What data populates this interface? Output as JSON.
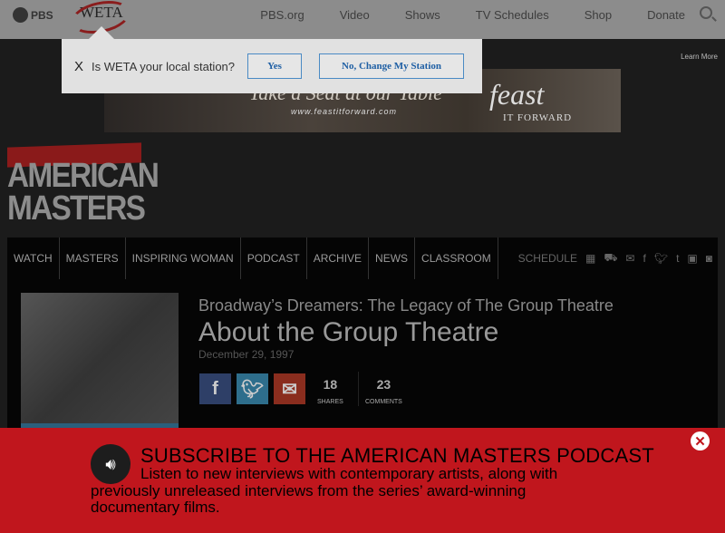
{
  "header": {
    "pbs": "PBS",
    "station": "WETA",
    "nav": [
      "PBS.org",
      "Video",
      "Shows",
      "TV Schedules",
      "Shop",
      "Donate"
    ]
  },
  "popup": {
    "question": "Is WETA your local station?",
    "yes": "Yes",
    "no": "No, Change My Station",
    "close": "X"
  },
  "ad": {
    "learn_more": "Learn More",
    "tagline": "Take a Seat at our Table",
    "url": "www.feastitforward.com",
    "brand": "feast",
    "brand_sub": "IT FORWARD"
  },
  "logo": {
    "line1": "AMERICAN",
    "line2": "MASTERS"
  },
  "menu": {
    "items": [
      "WATCH",
      "MASTERS",
      "INSPIRING WOMAN",
      "PODCAST",
      "ARCHIVE",
      "NEWS",
      "CLASSROOM"
    ],
    "schedule": "SCHEDULE"
  },
  "article": {
    "series": "Broadway’s Dreamers: The Legacy of The Group Theatre",
    "title": "About the Group Theatre",
    "date": "December 29, 1997",
    "shares": "18",
    "shares_label": "SHARES",
    "comments": "23",
    "comments_label": "COMMENTS"
  },
  "banner": {
    "title": "SUBSCRIBE TO THE AMERICAN MASTERS PODCAST",
    "body": "Listen to new interviews with contemporary artists, along with previously unreleased interviews from the series’ award-winning documentary films.",
    "color": "#c0161d"
  }
}
